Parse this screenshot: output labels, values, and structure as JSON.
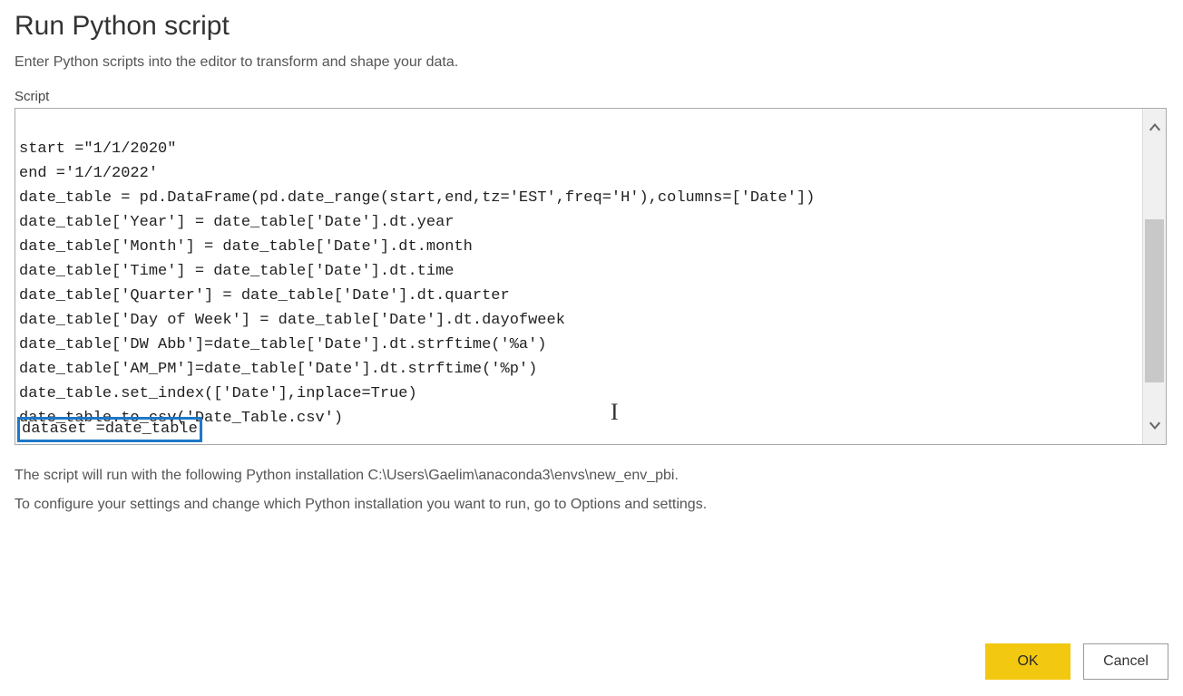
{
  "dialog": {
    "title": "Run Python script",
    "subtitle": "Enter Python scripts into the editor to transform and shape your data.",
    "script_label": "Script",
    "info_line1": "The script will run with the following Python installation C:\\Users\\Gaelim\\anaconda3\\envs\\new_env_pbi.",
    "info_line2": "To configure your settings and change which Python installation you want to run, go to Options and settings."
  },
  "script": {
    "lines": [
      "start =\"1/1/2020\"",
      "end ='1/1/2022'",
      "date_table = pd.DataFrame(pd.date_range(start,end,tz='EST',freq='H'),columns=['Date'])",
      "date_table['Year'] = date_table['Date'].dt.year",
      "date_table['Month'] = date_table['Date'].dt.month",
      "date_table['Time'] = date_table['Date'].dt.time",
      "date_table['Quarter'] = date_table['Date'].dt.quarter",
      "date_table['Day of Week'] = date_table['Date'].dt.dayofweek",
      "date_table['DW Abb']=date_table['Date'].dt.strftime('%a')",
      "date_table['AM_PM']=date_table['Date'].dt.strftime('%p')",
      "date_table.set_index(['Date'],inplace=True)",
      "date_table.to_csv('Date_Table.csv')"
    ],
    "highlighted_line": "dataset =date_table"
  },
  "buttons": {
    "ok": "OK",
    "cancel": "Cancel"
  }
}
